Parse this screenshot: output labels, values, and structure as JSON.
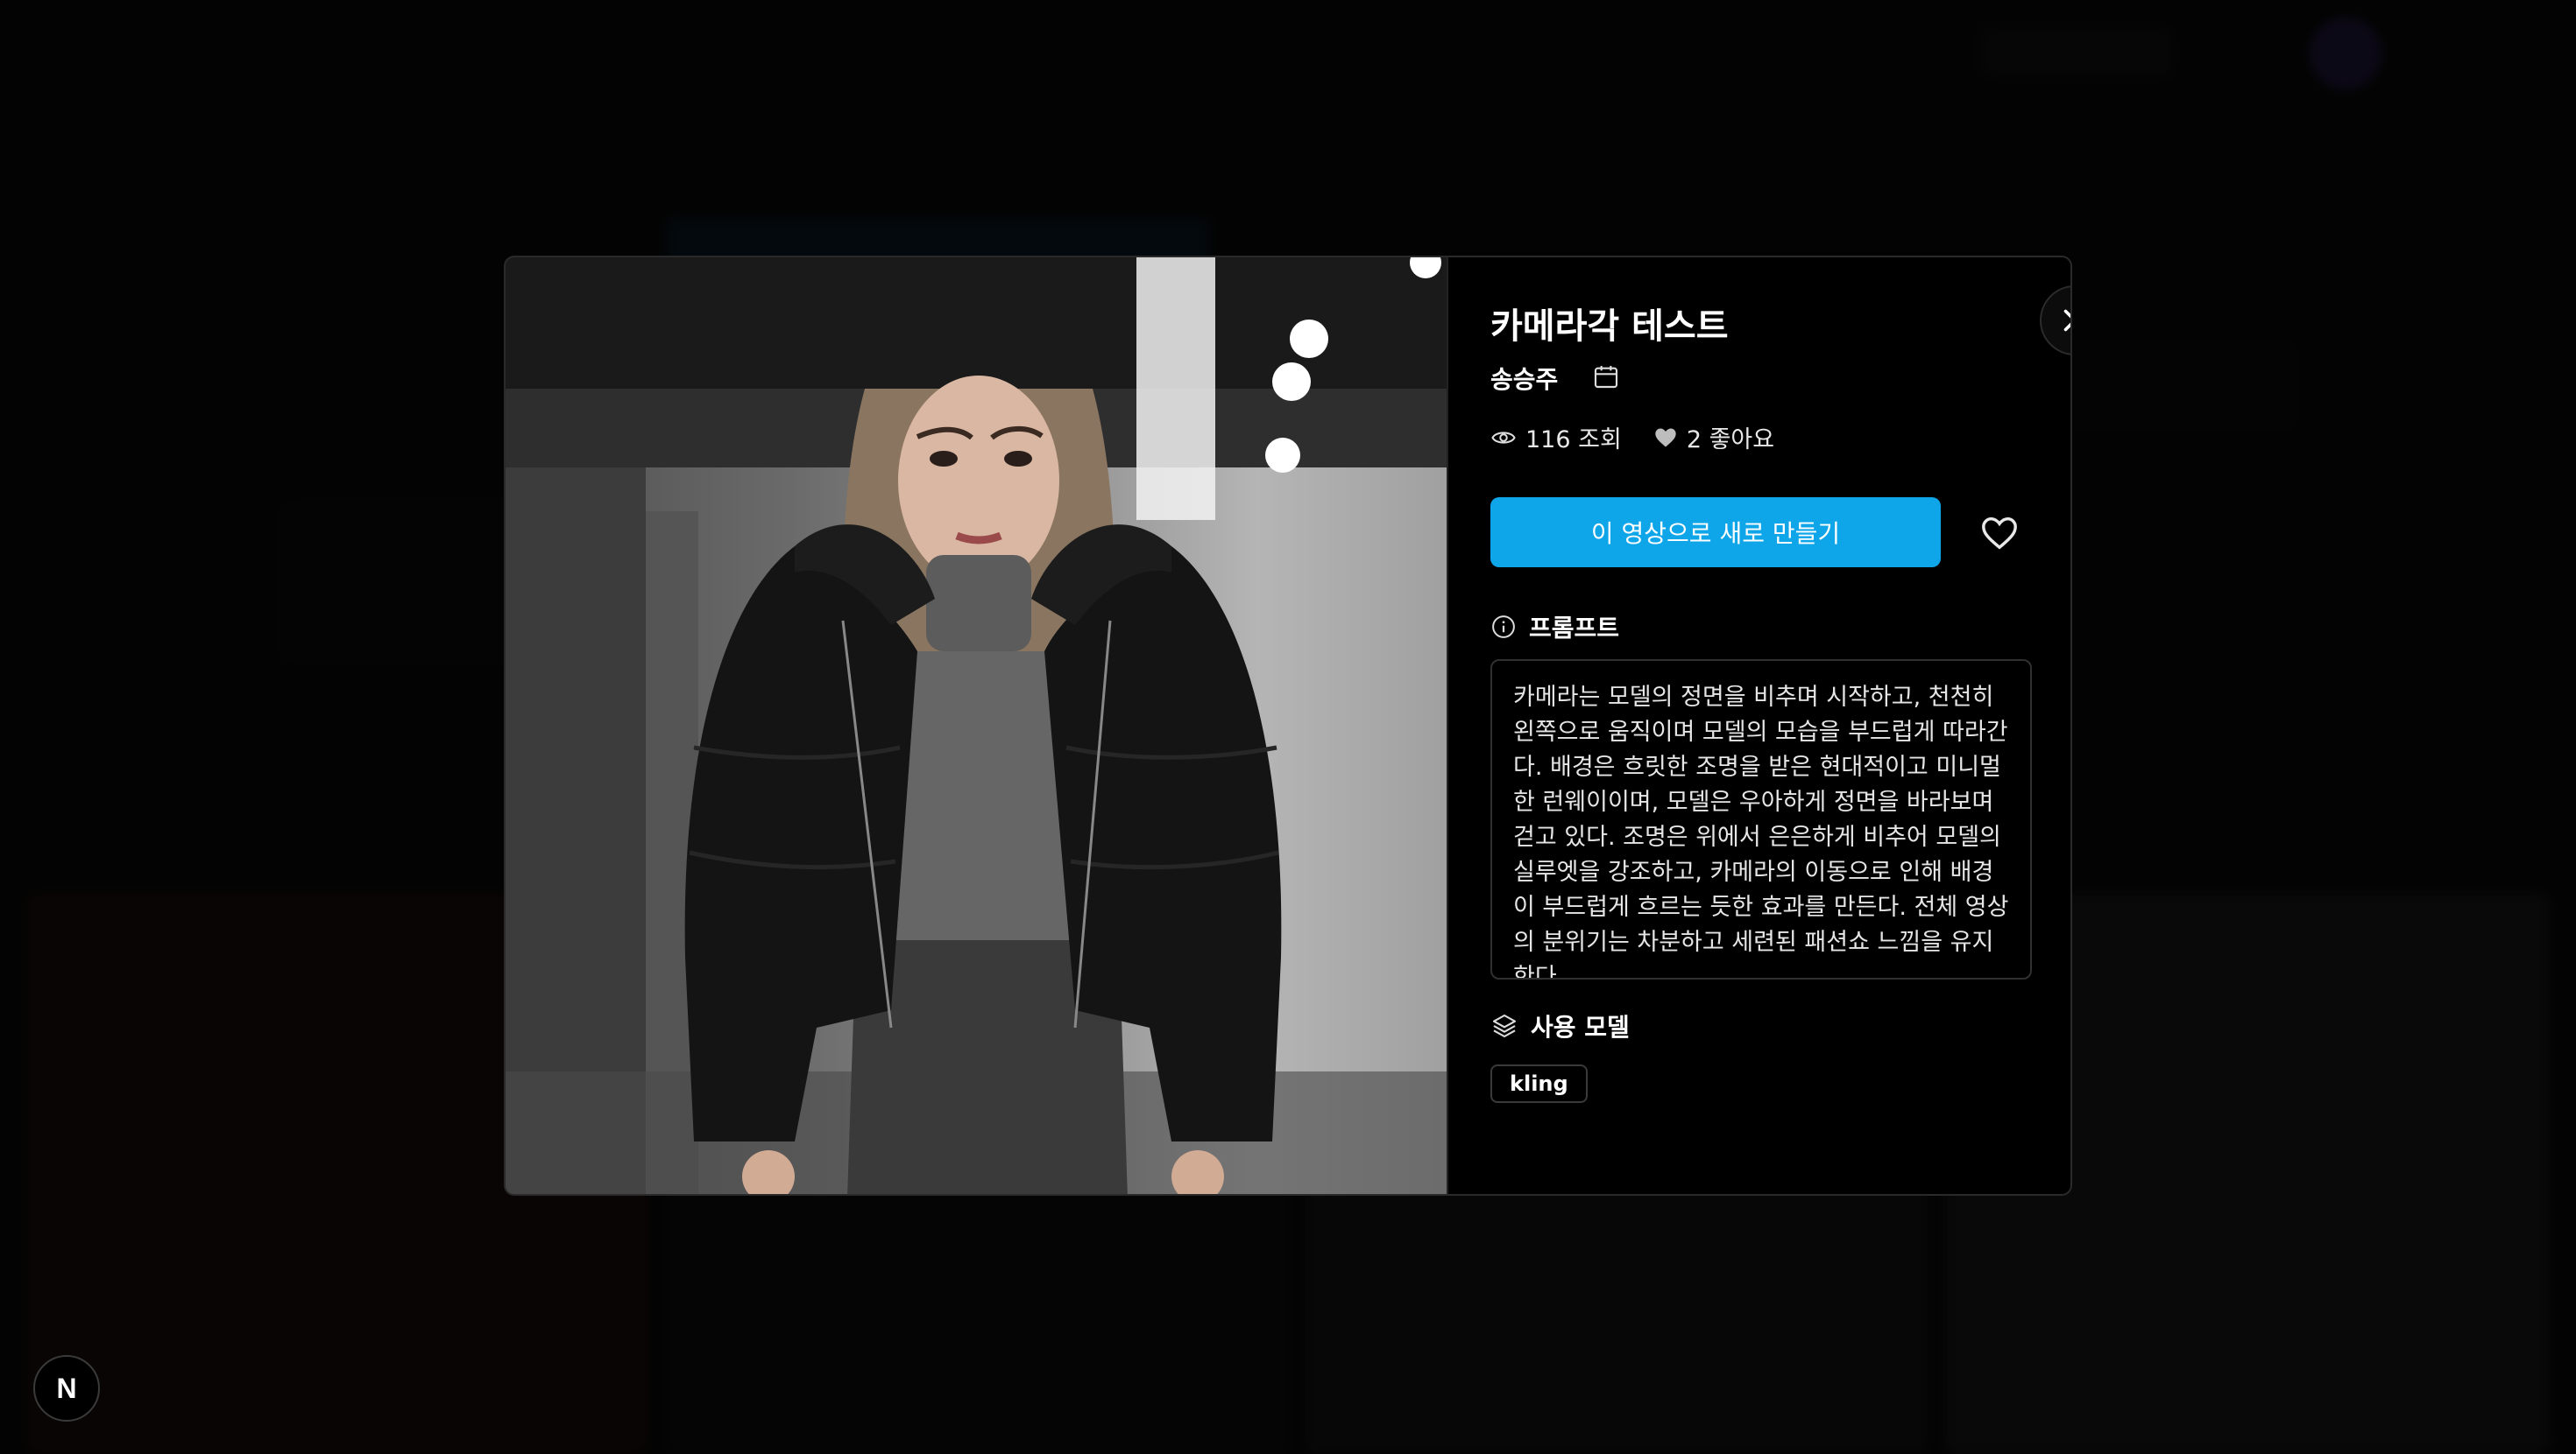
{
  "modal": {
    "title": "카메라각 테스트",
    "author": "송승주",
    "views": "116 조회",
    "likes": "2 좋아요",
    "cta_label": "이 영상으로 새로 만들기",
    "prompt_heading": "프롬프트",
    "prompt_text": "카메라는 모델의 정면을 비추며 시작하고, 천천히 왼쪽으로 움직이며 모델의 모습을 부드럽게 따라간다. 배경은 흐릿한 조명을 받은 현대적이고 미니멀한 런웨이이며, 모델은 우아하게 정면을 바라보며 걷고 있다. 조명은 위에서 은은하게 비추어 모델의 실루엣을 강조하고, 카메라의 이동으로 인해 배경이 부드럽게 흐르는 듯한 효과를 만든다. 전체 영상의 분위기는 차분하고 세련된 패션쇼 느낌을 유지한다.",
    "model_heading": "사용 모델",
    "model_tag": "kling"
  },
  "dev_badge": "N",
  "colors": {
    "accent": "#0ea5e9",
    "modal_bg": "#000000",
    "overlay": "rgba(0,0,0,0.78)"
  },
  "icons": {
    "close": "close-icon",
    "calendar": "calendar-icon",
    "views": "eye-icon",
    "likes": "heart-filled-icon",
    "like_button": "heart-outline-icon",
    "prompt": "info-icon",
    "model": "layers-icon"
  }
}
